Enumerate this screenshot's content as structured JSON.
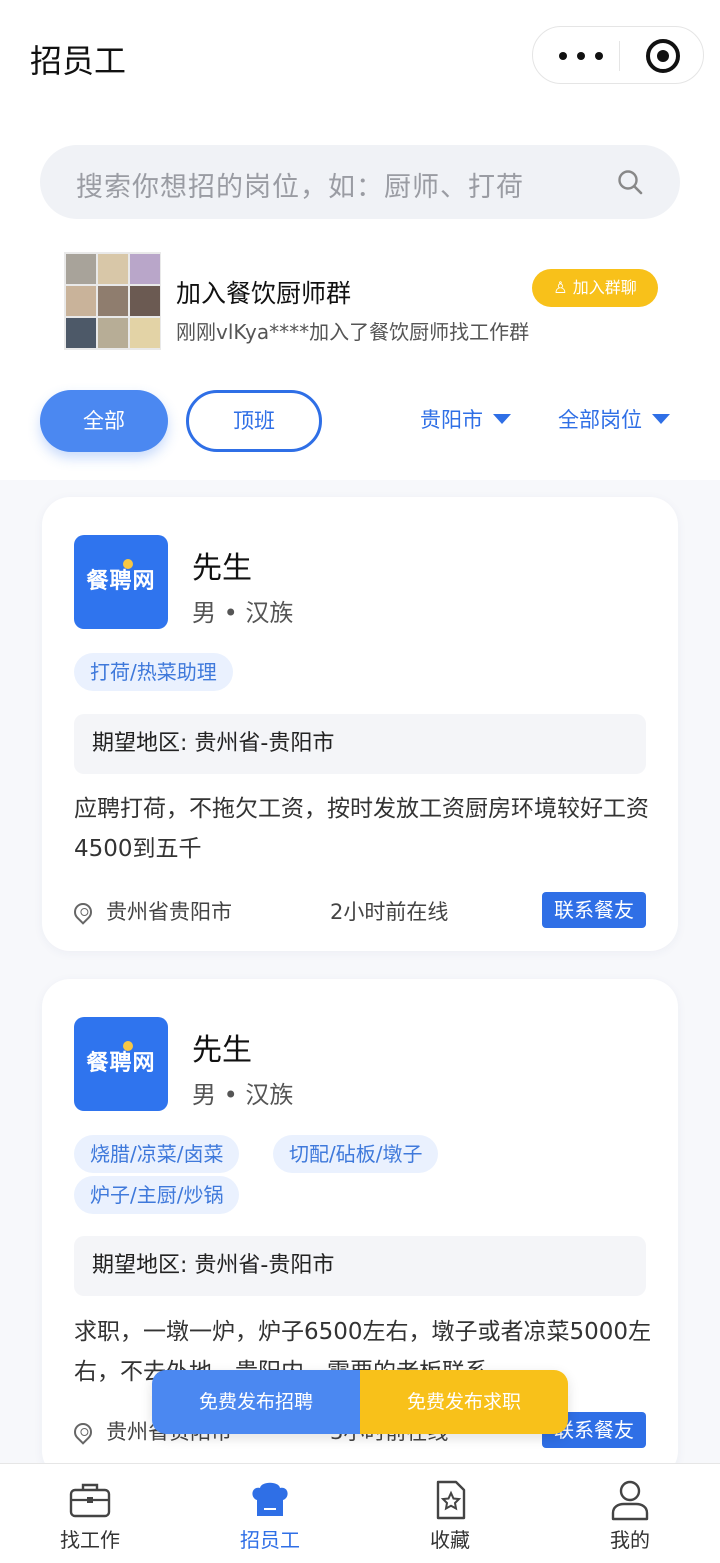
{
  "header": {
    "title": "招员工"
  },
  "search": {
    "placeholder": "搜索你想招的岗位，如：厨师、打荷"
  },
  "group": {
    "name": "加入餐饮厨师群",
    "subtitle": "刚刚vlKya****加入了餐饮厨师找工作群",
    "join_label": "加入群聊"
  },
  "filters": {
    "all_label": "全部",
    "top_label": "顶班",
    "city": "贵阳市",
    "position": "全部岗位"
  },
  "cards": [
    {
      "logo_text": "餐聘网",
      "name": "先生",
      "meta": "男 • 汉族",
      "tags": [
        "打荷/热菜助理"
      ],
      "region": "期望地区: 贵州省-贵阳市",
      "description": "应聘打荷，不拖欠工资，按时发放工资厨房环境较好工资4500到五千",
      "location": "贵州省贵阳市",
      "online": "2小时前在线",
      "contact_label": "联系餐友"
    },
    {
      "logo_text": "餐聘网",
      "name": "先生",
      "meta": "男 • 汉族",
      "tags": [
        "烧腊/凉菜/卤菜",
        "切配/砧板/墩子",
        "炉子/主厨/炒锅"
      ],
      "region": "期望地区: 贵州省-贵阳市",
      "description": "求职，一墩一炉，炉子6500左右，墩子或者凉菜5000左右，不去外地，贵阳内，需要的老板联系",
      "location": "贵州省贵阳市",
      "online": "3小时前在线",
      "contact_label": "联系餐友"
    }
  ],
  "float_buttons": {
    "hire": "免费发布招聘",
    "seek": "免费发布求职"
  },
  "tabbar": [
    {
      "label": "找工作",
      "icon": "briefcase-icon"
    },
    {
      "label": "招员工",
      "icon": "chef-hat-icon",
      "active": true
    },
    {
      "label": "收藏",
      "icon": "star-card-icon"
    },
    {
      "label": "我的",
      "icon": "user-icon"
    }
  ],
  "colors": {
    "primary": "#2f6fe6",
    "accent": "#f8c11a"
  }
}
